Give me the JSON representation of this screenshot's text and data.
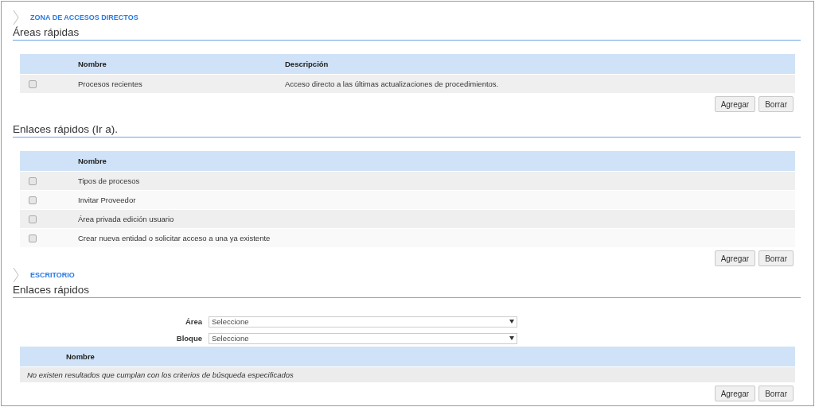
{
  "sections": [
    {
      "label": "ZONA DE ACCESOS DIRECTOS",
      "panels": [
        {
          "heading": "Áreas rápidas",
          "table": {
            "columns": [
              "Nombre",
              "Descripción"
            ],
            "rows": [
              {
                "checked": false,
                "cells": [
                  "Procesos recientes",
                  "Acceso directo a las últimas actualizaciones de procedimientos."
                ]
              }
            ]
          },
          "buttons": [
            "Agregar",
            "Borrar"
          ]
        },
        {
          "heading": "Enlaces rápidos (Ir a).",
          "table": {
            "columns": [
              "Nombre"
            ],
            "rows": [
              {
                "checked": false,
                "cells": [
                  "Tipos de procesos"
                ]
              },
              {
                "checked": false,
                "cells": [
                  "Invitar Proveedor"
                ]
              },
              {
                "checked": false,
                "cells": [
                  "Área privada edición usuario"
                ]
              },
              {
                "checked": false,
                "cells": [
                  "Crear nueva entidad o solicitar acceso a una ya existente"
                ]
              }
            ]
          },
          "buttons": [
            "Agregar",
            "Borrar"
          ]
        }
      ]
    },
    {
      "label": "ESCRITORIO",
      "panels": [
        {
          "heading": "Enlaces rápidos",
          "filters": [
            {
              "label": "Área",
              "value": "Seleccione"
            },
            {
              "label": "Bloque",
              "value": "Seleccione"
            }
          ],
          "table": {
            "columns": [
              "Nombre"
            ],
            "empty_message": "No existen resultados que cumplan con los criterios de búsqueda especificados"
          },
          "buttons": [
            "Agregar",
            "Borrar"
          ]
        }
      ]
    }
  ]
}
